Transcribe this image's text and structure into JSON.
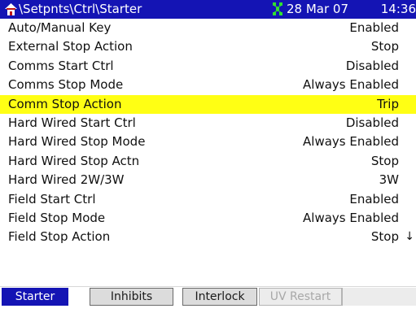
{
  "title_bar": {
    "home_icon": "home-icon",
    "path": "\\Setpnts\\Ctrl\\Starter",
    "network_icon": "network-status-icon",
    "date": "28 Mar 07",
    "time": "14:36"
  },
  "parameters": [
    {
      "label": "Auto/Manual Key",
      "value": "Enabled",
      "selected": false
    },
    {
      "label": "External Stop Action",
      "value": "Stop",
      "selected": false
    },
    {
      "label": "Comms Start Ctrl",
      "value": "Disabled",
      "selected": false
    },
    {
      "label": "Comms Stop Mode",
      "value": "Always Enabled",
      "selected": false
    },
    {
      "label": "Comm Stop Action",
      "value": "Trip",
      "selected": true
    },
    {
      "label": "Hard Wired Start Ctrl",
      "value": "Disabled",
      "selected": false
    },
    {
      "label": "Hard Wired Stop Mode",
      "value": "Always Enabled",
      "selected": false
    },
    {
      "label": "Hard Wired Stop Actn",
      "value": "Stop",
      "selected": false
    },
    {
      "label": "Hard Wired 2W/3W",
      "value": "3W",
      "selected": false
    },
    {
      "label": "Field Start Ctrl",
      "value": "Enabled",
      "selected": false
    },
    {
      "label": "Field Stop Mode",
      "value": "Always Enabled",
      "selected": false
    },
    {
      "label": "Field Stop Action",
      "value": "Stop",
      "selected": false
    }
  ],
  "scroll_indicator": "↓",
  "tabs": [
    {
      "label": "Starter",
      "state": "active"
    },
    {
      "label": "Inhibits",
      "state": "normal"
    },
    {
      "label": "Interlock",
      "state": "normal"
    },
    {
      "label": "UV Restart",
      "state": "disabled"
    }
  ],
  "colors": {
    "title_bar_bg": "#1414b4",
    "selected_row_bg": "#ffff14",
    "active_tab_bg": "#1414b4",
    "text": "#101010"
  }
}
